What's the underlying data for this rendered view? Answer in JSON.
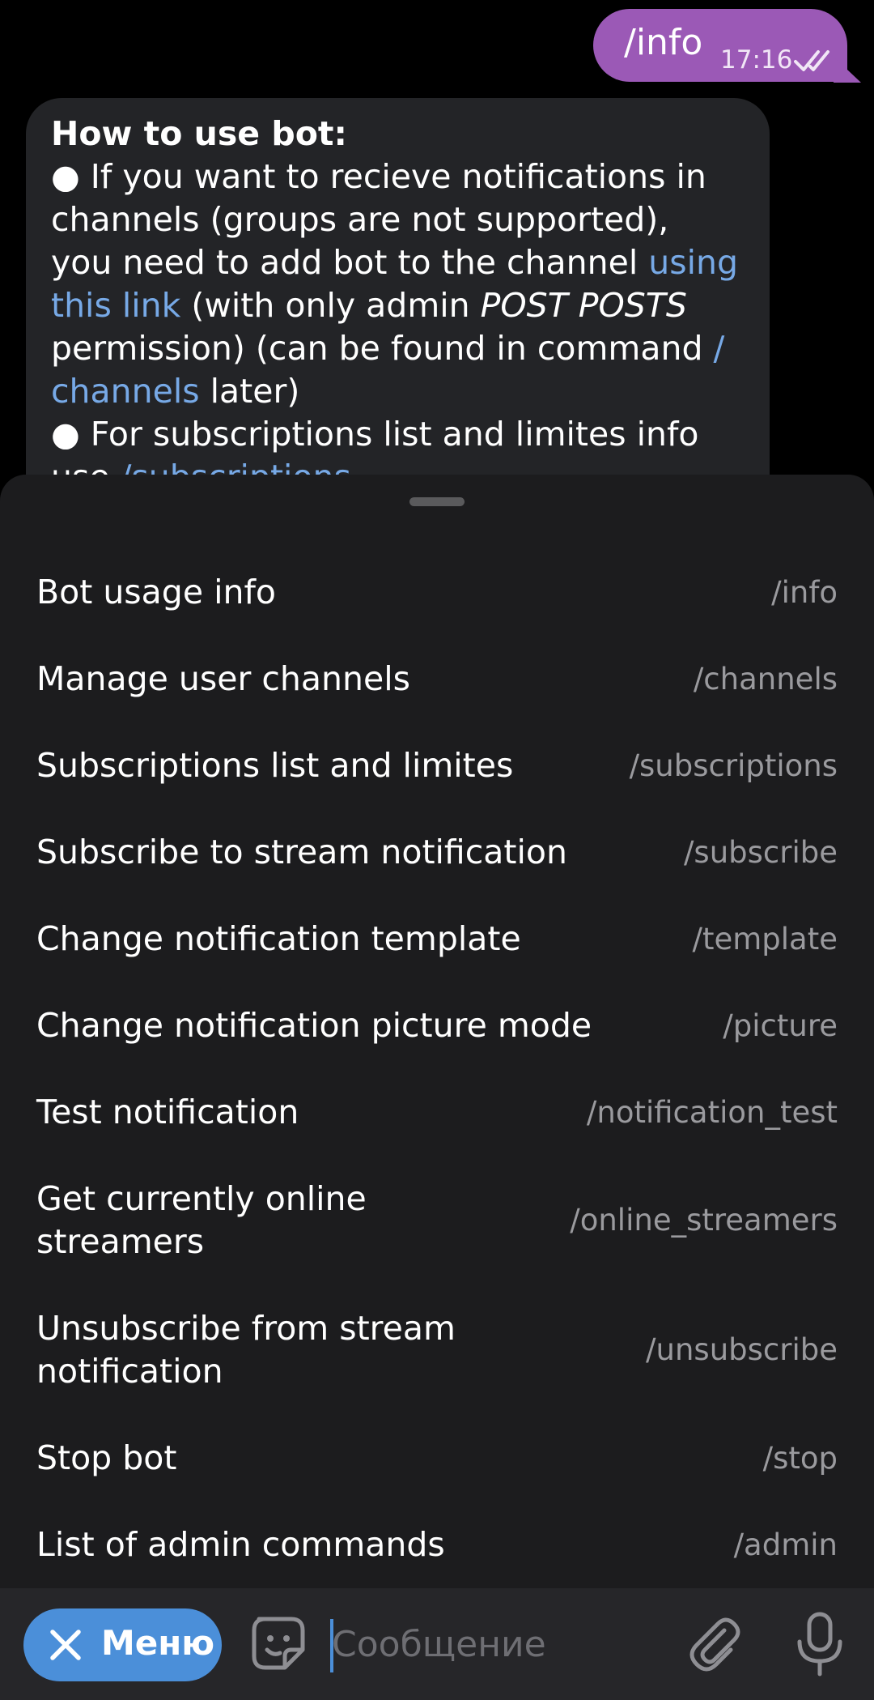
{
  "outgoing": {
    "text": "/info",
    "time": "17:16"
  },
  "incoming": {
    "title": "How to use bot:",
    "lines": [
      {
        "segments": [
          "● If you want to recieve notifications in"
        ]
      },
      {
        "segments": [
          "channels (groups are not supported),"
        ]
      },
      {
        "segments": [
          "you need to add bot to the channel ",
          "using"
        ]
      },
      {
        "segments": [
          "this link",
          " (with only admin ",
          "POST POSTS"
        ]
      },
      {
        "segments": [
          "permission) (can be found in command ",
          "/"
        ]
      },
      {
        "segments": [
          "channels",
          " later)"
        ]
      },
      {
        "segments": [
          "● For subscriptions list and limites info"
        ]
      },
      {
        "segments": [
          "use ",
          "/subscriptions"
        ]
      }
    ],
    "link_color": "#77a9e6"
  },
  "commands": [
    {
      "name": "Bot usage info",
      "code": "/info"
    },
    {
      "name": "Manage user channels",
      "code": "/channels"
    },
    {
      "name": "Subscriptions list and limites",
      "code": "/subscriptions"
    },
    {
      "name": "Subscribe to stream notification",
      "code": "/subscribe"
    },
    {
      "name": "Change notification template",
      "code": "/template"
    },
    {
      "name": "Change notification picture mode",
      "code": "/picture"
    },
    {
      "name": "Test notification",
      "code": "/notification_test"
    },
    {
      "name": "Get currently online streamers",
      "code": "/online_streamers"
    },
    {
      "name": "Unsubscribe from stream notification",
      "code": "/unsubscribe"
    },
    {
      "name": "Stop bot",
      "code": "/stop"
    },
    {
      "name": "List of admin commands",
      "code": "/admin"
    }
  ],
  "input_bar": {
    "menu_label": "Меню",
    "placeholder": "Сообщение",
    "icons": [
      "close-icon",
      "sticker-icon",
      "attach-icon",
      "microphone-icon"
    ]
  },
  "colors": {
    "accent": "#4b8fd9",
    "outgoing_bubble": "#9b59b6",
    "sheet": "#1c1c1e"
  }
}
